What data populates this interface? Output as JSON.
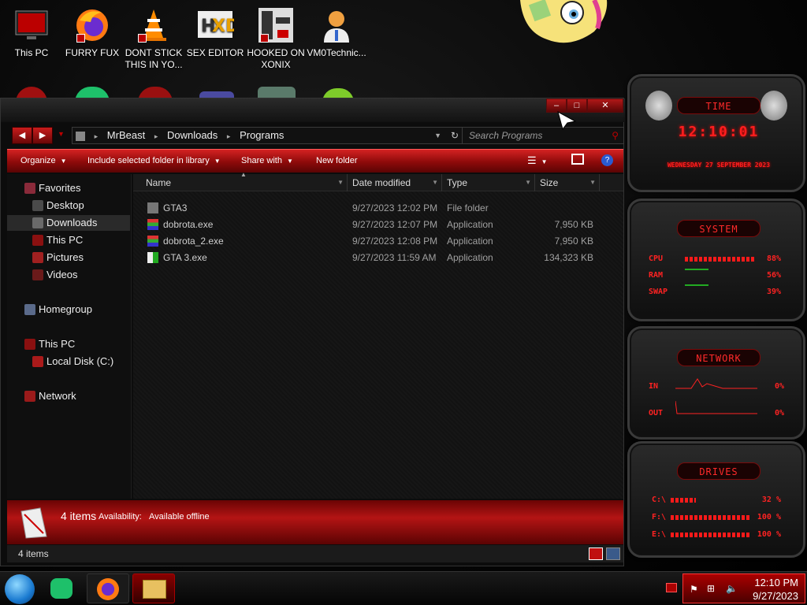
{
  "desktop": {
    "icons": [
      {
        "label": "This PC"
      },
      {
        "label": "FURRY FUX"
      },
      {
        "label": "DONT STICK THIS IN YO..."
      },
      {
        "label": "SEX EDITOR"
      },
      {
        "label": "HOOKED ON XONIX"
      },
      {
        "label": "VM0Technic..."
      }
    ]
  },
  "explorer": {
    "breadcrumb": [
      "MrBeast",
      "Downloads",
      "Programs"
    ],
    "search_placeholder": "Search Programs",
    "toolbar": {
      "organize": "Organize",
      "include": "Include selected folder in library",
      "share": "Share with",
      "newfolder": "New folder"
    },
    "nav": {
      "favorites": "Favorites",
      "desktop": "Desktop",
      "downloads": "Downloads",
      "thispc_fav": "This PC",
      "pictures": "Pictures",
      "videos": "Videos",
      "homegroup": "Homegroup",
      "thispc": "This PC",
      "localdisk": "Local Disk (C:)",
      "network": "Network"
    },
    "columns": {
      "name": "Name",
      "date": "Date modified",
      "type": "Type",
      "size": "Size"
    },
    "files": [
      {
        "name": "GTA3",
        "date": "9/27/2023 12:02 PM",
        "type": "File folder",
        "size": "",
        "icon": "folder-icon"
      },
      {
        "name": "dobrota.exe",
        "date": "9/27/2023 12:07 PM",
        "type": "Application",
        "size": "7,950 KB",
        "icon": "installer-icon"
      },
      {
        "name": "dobrota_2.exe",
        "date": "9/27/2023 12:08 PM",
        "type": "Application",
        "size": "7,950 KB",
        "icon": "installer-icon"
      },
      {
        "name": "GTA 3.exe",
        "date": "9/27/2023 11:59 AM",
        "type": "Application",
        "size": "134,323 KB",
        "icon": "gta-app-icon"
      }
    ],
    "details": {
      "count": "4 items",
      "availability_label": "Availability:",
      "availability_value": "Available offline"
    },
    "status": "4 items"
  },
  "gadgets": {
    "time": {
      "title": "TIME",
      "clock": "12:10:01",
      "date": "WEDNESDAY 27 SEPTEMBER 2023"
    },
    "system": {
      "title": "SYSTEM",
      "cpu_label": "CPU",
      "cpu": "88%",
      "ram_label": "RAM",
      "ram": "56%",
      "swap_label": "SWAP",
      "swap": "39%",
      "cpu_level": 0.88,
      "ram_level": 0.56,
      "swap_level": 0.39
    },
    "network": {
      "title": "NETWORK",
      "in_label": "IN",
      "in": "0%",
      "out_label": "OUT",
      "out": "0%"
    },
    "drives": {
      "title": "DRIVES",
      "c_label": "C:\\",
      "c": "32 %",
      "f_label": "F:\\",
      "f": "100 %",
      "e_label": "E:\\",
      "e": "100 %",
      "c_level": 0.32,
      "f_level": 1.0,
      "e_level": 1.0
    }
  },
  "taskbar": {
    "time": "12:10 PM",
    "date": "9/27/2023"
  },
  "colors": {
    "accent": "#c01010",
    "accent_dark": "#5a0404",
    "gadget_text": "#ff2222"
  }
}
